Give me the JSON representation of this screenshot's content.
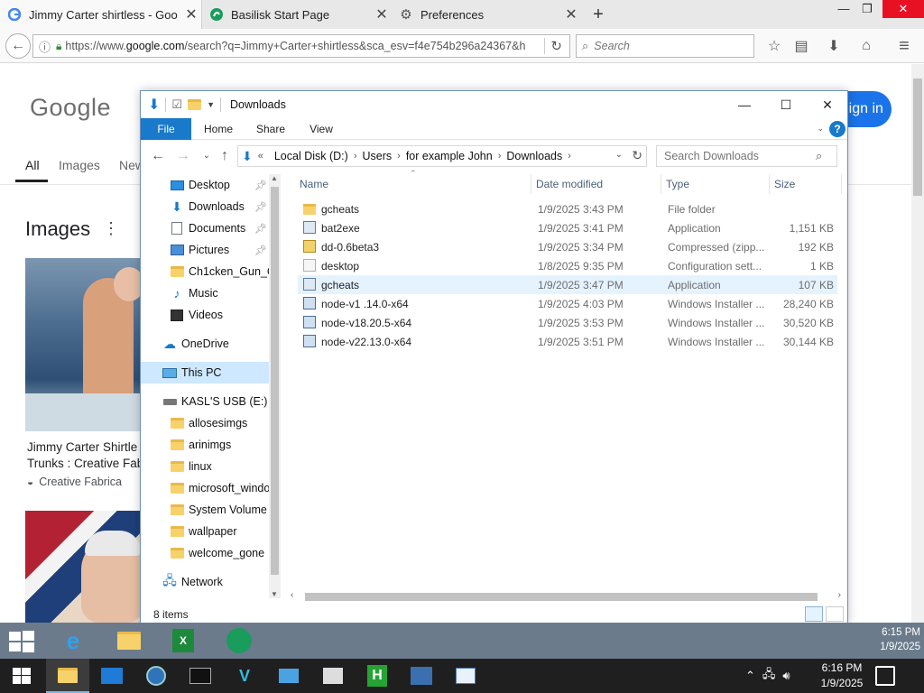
{
  "browser": {
    "tabs": [
      {
        "title": "Jimmy Carter shirtless - Goo",
        "active": true
      },
      {
        "title": "Basilisk Start Page",
        "active": false
      },
      {
        "title": "Preferences",
        "active": false
      }
    ],
    "new_tab": "+",
    "window": {
      "minimize": "—",
      "restore": "❐",
      "close": "✕"
    },
    "url_prefix": "https://www.",
    "url_domain": "google.com",
    "url_rest": "/search?q=Jimmy+Carter+shirtless&sca_esv=f4e754b296a24367&h",
    "search_placeholder": "Search"
  },
  "google": {
    "logo": "Google",
    "signin": "Sign in",
    "tabs": [
      "All",
      "Images",
      "New"
    ],
    "images_heading": "Images",
    "result1_caption_line1": "Jimmy Carter Shirtle",
    "result1_caption_line2": "Trunks : Creative Fab",
    "result1_source": "Creative Fabrica"
  },
  "explorer": {
    "title": "Downloads",
    "ribbon_tabs": [
      "File",
      "Home",
      "Share",
      "View"
    ],
    "breadcrumb": [
      "Local Disk (D:)",
      "Users",
      "for example John",
      "Downloads"
    ],
    "breadcrumb_prefix": "«",
    "search_placeholder": "Search Downloads",
    "nav": [
      {
        "label": "Desktop",
        "icon": "desktop-icon",
        "pinned": true
      },
      {
        "label": "Downloads",
        "icon": "downloads-icon",
        "pinned": true
      },
      {
        "label": "Documents",
        "icon": "documents-icon",
        "pinned": true
      },
      {
        "label": "Pictures",
        "icon": "pictures-icon",
        "pinned": true
      },
      {
        "label": "Ch1cken_Gun_C",
        "icon": "folder-icon",
        "pinned": false
      },
      {
        "label": "Music",
        "icon": "music-icon",
        "pinned": false
      },
      {
        "label": "Videos",
        "icon": "videos-icon",
        "pinned": false
      },
      {
        "label": "OneDrive",
        "icon": "onedrive-icon",
        "pinned": false
      },
      {
        "label": "This PC",
        "icon": "this-pc-icon",
        "pinned": false,
        "selected": true
      },
      {
        "label": "KASL'S USB (E:)",
        "icon": "usb-drive-icon",
        "pinned": false
      },
      {
        "label": "allosesimgs",
        "icon": "folder-icon",
        "pinned": false
      },
      {
        "label": "arinimgs",
        "icon": "folder-icon",
        "pinned": false
      },
      {
        "label": "linux",
        "icon": "folder-icon",
        "pinned": false
      },
      {
        "label": "microsoft_windo",
        "icon": "folder-icon",
        "pinned": false
      },
      {
        "label": "System Volume I",
        "icon": "folder-icon",
        "pinned": false
      },
      {
        "label": "wallpaper",
        "icon": "folder-icon",
        "pinned": false
      },
      {
        "label": "welcome_gone",
        "icon": "folder-icon",
        "pinned": false
      },
      {
        "label": "Network",
        "icon": "network-icon",
        "pinned": false
      }
    ],
    "columns": {
      "name": "Name",
      "date": "Date modified",
      "type": "Type",
      "size": "Size"
    },
    "files": [
      {
        "name": "gcheats",
        "date": "1/9/2025 3:43 PM",
        "type": "File folder",
        "size": "",
        "icon": "folder-icon"
      },
      {
        "name": "bat2exe",
        "date": "1/9/2025 3:41 PM",
        "type": "Application",
        "size": "1,151 KB",
        "icon": "application-icon"
      },
      {
        "name": "dd-0.6beta3",
        "date": "1/9/2025 3:34 PM",
        "type": "Compressed (zipp...",
        "size": "192 KB",
        "icon": "zip-icon"
      },
      {
        "name": "desktop",
        "date": "1/8/2025 9:35 PM",
        "type": "Configuration sett...",
        "size": "1 KB",
        "icon": "config-file-icon"
      },
      {
        "name": "gcheats",
        "date": "1/9/2025 3:47 PM",
        "type": "Application",
        "size": "107 KB",
        "icon": "application-icon",
        "hover": true
      },
      {
        "name": "node-v1 .14.0-x64",
        "date": "1/9/2025 4:03 PM",
        "type": "Windows Installer ...",
        "size": "28,240 KB",
        "icon": "installer-icon"
      },
      {
        "name": "node-v18.20.5-x64",
        "date": "1/9/2025 3:53 PM",
        "type": "Windows Installer ...",
        "size": "30,520 KB",
        "icon": "installer-icon"
      },
      {
        "name": "node-v22.13.0-x64",
        "date": "1/9/2025 3:51 PM",
        "type": "Windows Installer ...",
        "size": "30,144 KB",
        "icon": "installer-icon"
      }
    ],
    "status": "8 items"
  },
  "remote_taskbar": {
    "time": "6:15 PM",
    "date": "1/9/2025"
  },
  "taskbar": {
    "time": "6:16 PM",
    "date": "1/9/2025"
  },
  "colors": {
    "accent": "#1979ca",
    "google_blue": "#1a73e8",
    "close_red": "#e81123"
  }
}
